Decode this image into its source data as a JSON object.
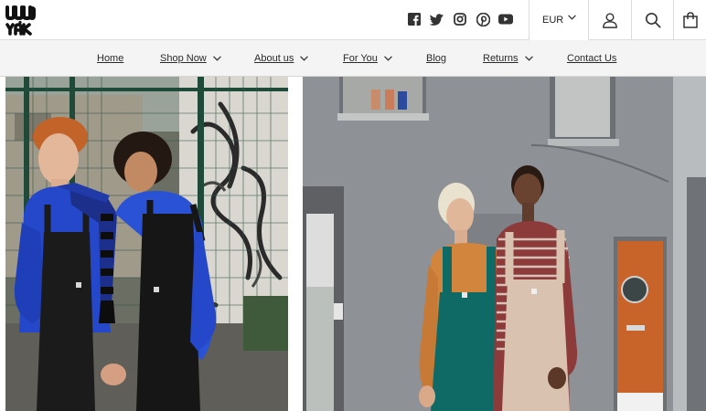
{
  "brand": {
    "logo_lines": [
      "LUCY",
      "& YAK"
    ]
  },
  "header": {
    "social_icons": [
      "facebook-icon",
      "twitter-icon",
      "instagram-icon",
      "pinterest-icon",
      "youtube-icon"
    ],
    "currency": "EUR",
    "account_icon": "user-icon",
    "search_icon": "search-icon",
    "cart_icon": "shopping-bag-icon"
  },
  "nav": {
    "items": [
      {
        "label": "Home",
        "has_dropdown": false
      },
      {
        "label": "Shop Now",
        "has_dropdown": true
      },
      {
        "label": "About us",
        "has_dropdown": true
      },
      {
        "label": "For You",
        "has_dropdown": true
      },
      {
        "label": "Blog",
        "has_dropdown": false
      },
      {
        "label": "Returns",
        "has_dropdown": true
      },
      {
        "label": "Contact Us",
        "has_dropdown": false
      }
    ]
  },
  "hero": {
    "left_image": "photo-two-models-blue-jumpers-black-dungarees",
    "right_image": "photo-two-models-teal-and-pink-dungarees"
  },
  "colors": {
    "nav_bg": "#f4f4f4",
    "border": "#dcdcdc",
    "text": "#222222",
    "cobalt": "#2448c9",
    "teal": "#0f6a66"
  }
}
